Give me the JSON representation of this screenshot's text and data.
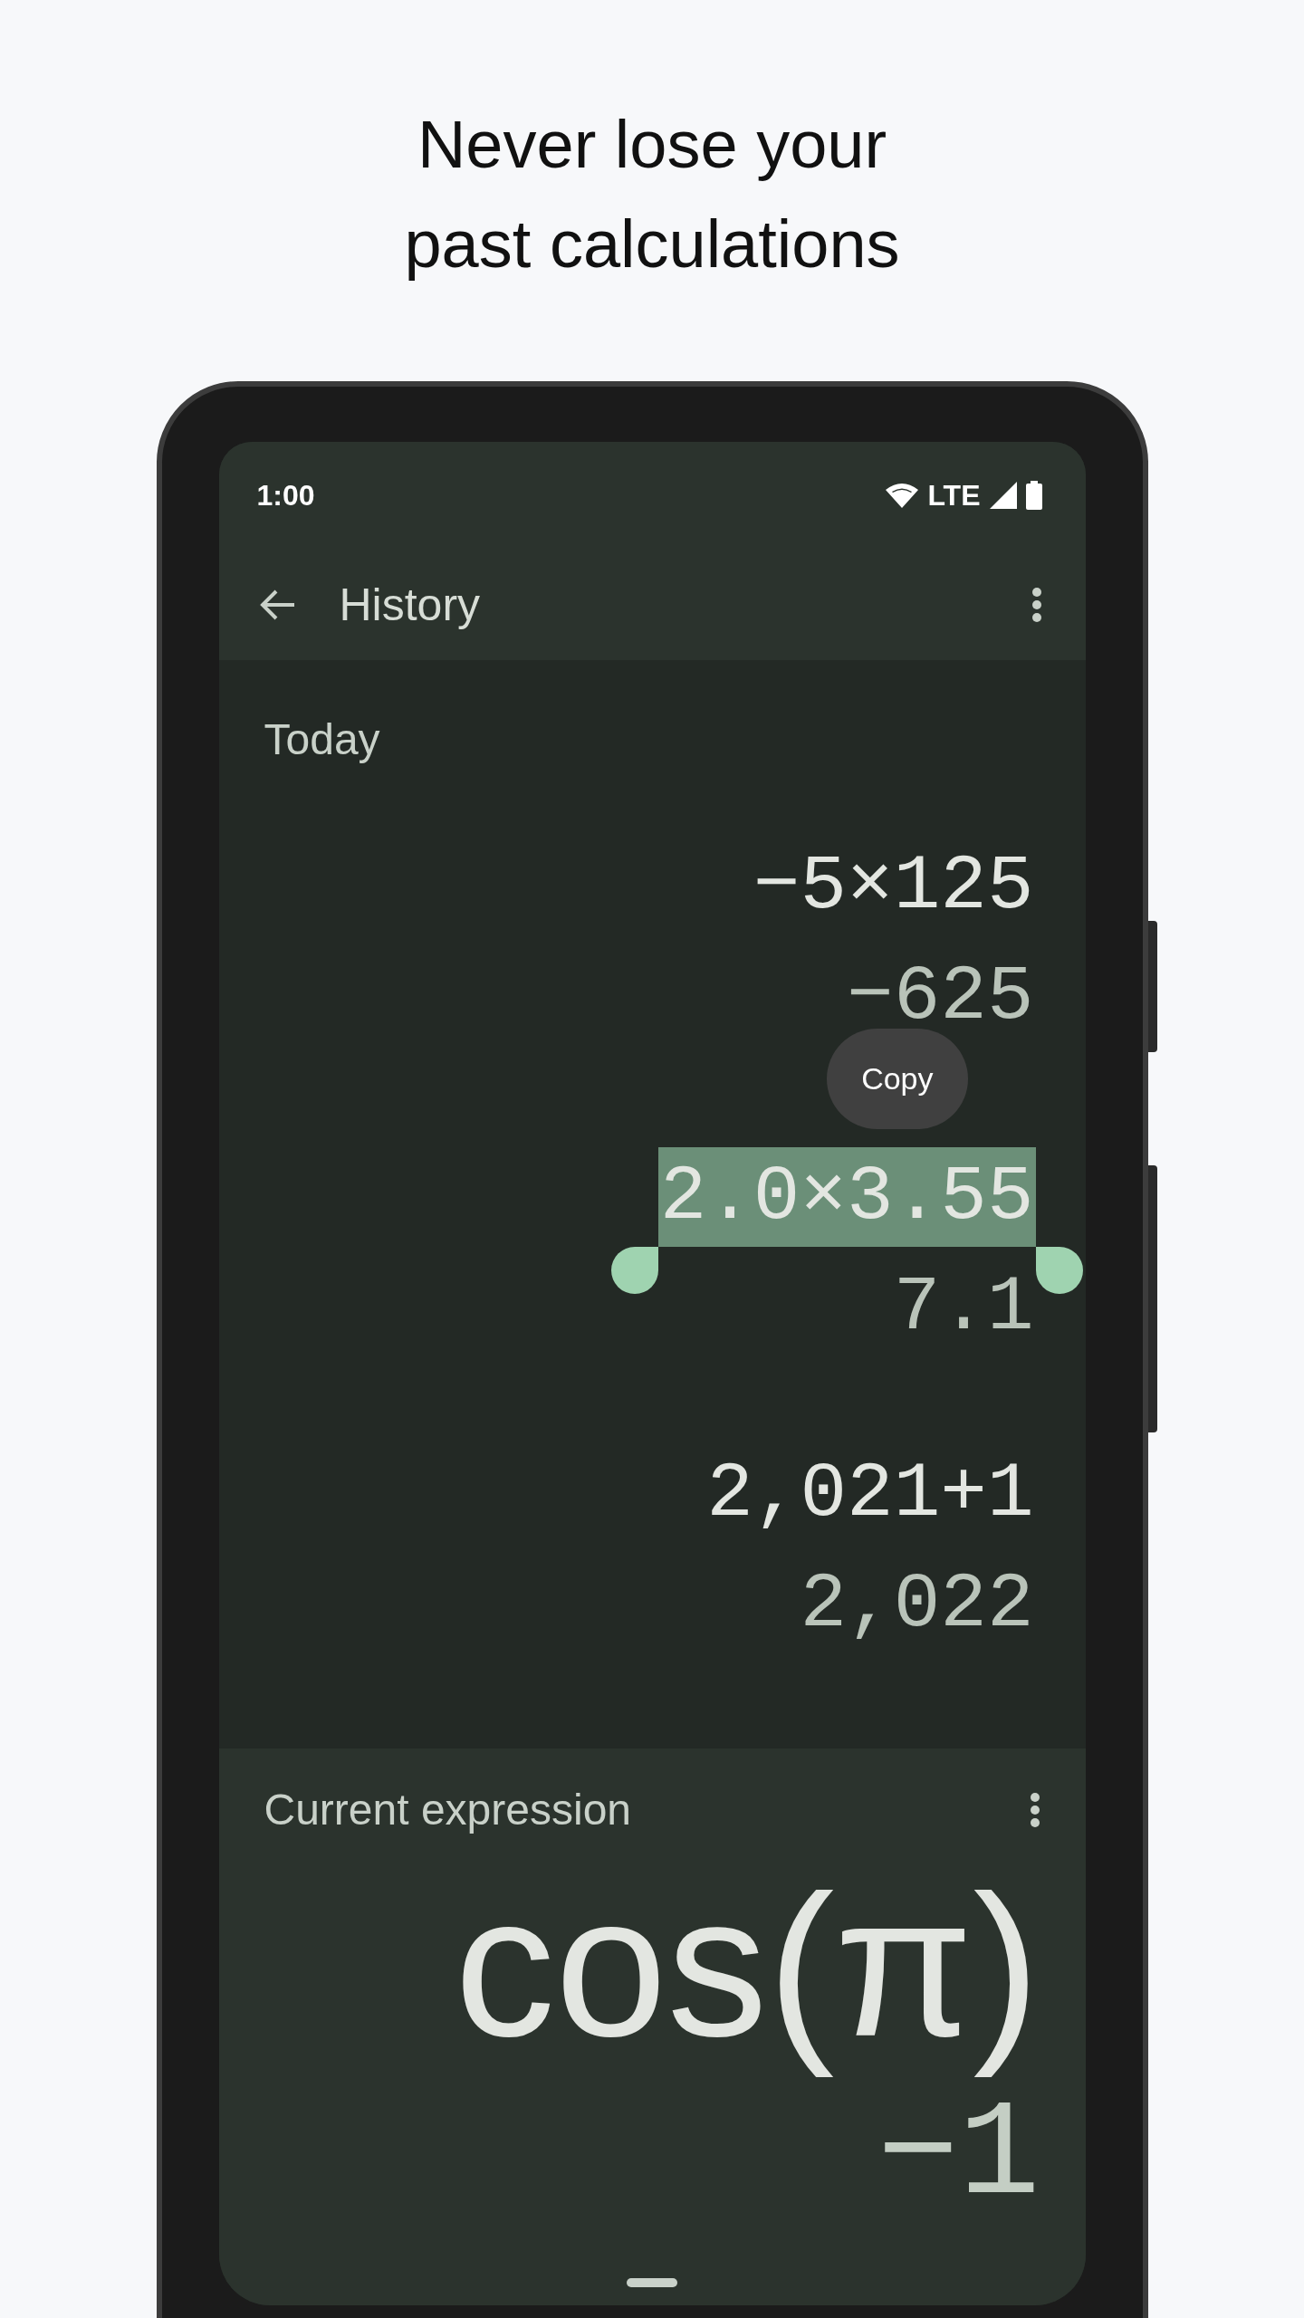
{
  "headline": [
    "Never lose your",
    "past calculations"
  ],
  "status_bar": {
    "time": "1:00",
    "network": "LTE"
  },
  "app_bar": {
    "title": "History"
  },
  "section": "Today",
  "history": [
    {
      "expression": "−5×125",
      "result": "−625",
      "selected": false
    },
    {
      "popup": "Copy",
      "expression": "2.0×3.55",
      "result": "7.1",
      "selected": true
    },
    {
      "expression": "2,021+1",
      "result": "2,022",
      "selected": false
    }
  ],
  "current": {
    "label": "Current expression",
    "expression": "cos(π)",
    "result": "−1"
  }
}
